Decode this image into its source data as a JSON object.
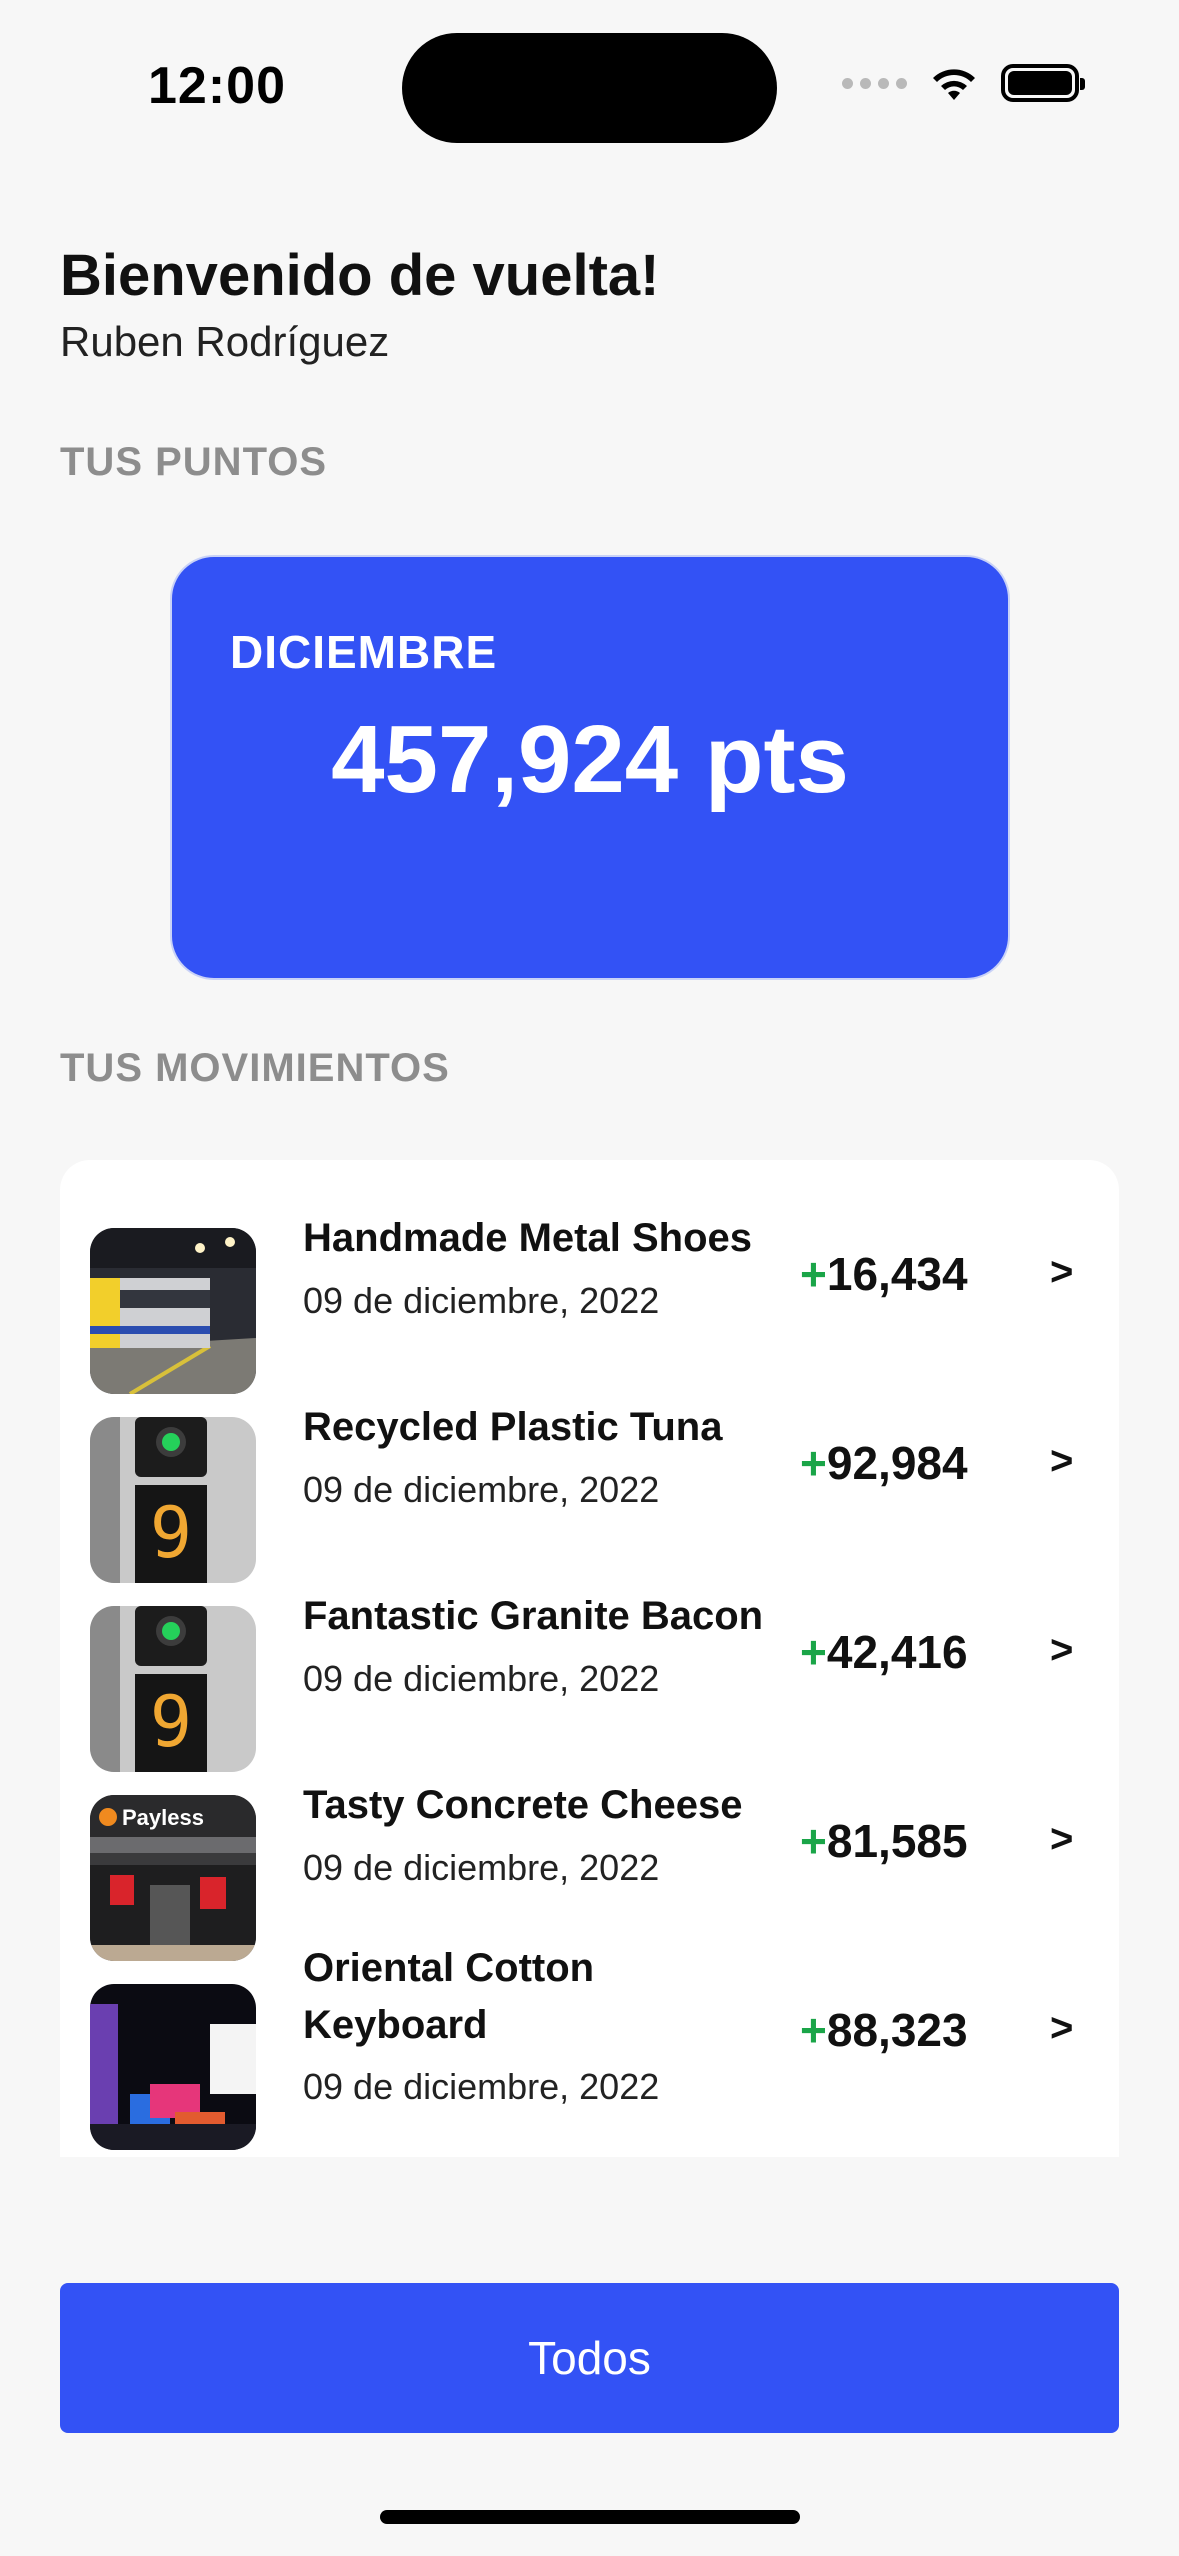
{
  "status_bar": {
    "time": "12:00",
    "icons": [
      "cellular-signal-icon",
      "wifi-icon",
      "battery-icon"
    ]
  },
  "header": {
    "greeting": "Bienvenido de vuelta!",
    "user_name": "Ruben Rodríguez"
  },
  "points": {
    "section_label": "TUS PUNTOS",
    "month": "DICIEMBRE",
    "value": "457,924 pts"
  },
  "movements": {
    "section_label": "TUS MOVIMIENTOS",
    "items": [
      {
        "title": "Handmade Metal Shoes",
        "date": "09 de diciembre, 2022",
        "sign": "+",
        "amount": "16,434",
        "thumb": "train-photo"
      },
      {
        "title": "Recycled Plastic Tuna",
        "date": "09 de diciembre, 2022",
        "sign": "+",
        "amount": "92,984",
        "thumb": "signal-photo"
      },
      {
        "title": "Fantastic Granite Bacon",
        "date": "09 de diciembre, 2022",
        "sign": "+",
        "amount": "42,416",
        "thumb": "signal-photo"
      },
      {
        "title": "Tasty Concrete Cheese",
        "date": "09 de diciembre, 2022",
        "sign": "+",
        "amount": "81,585",
        "thumb": "storefront-photo"
      },
      {
        "title": "Oriental Cotton Keyboard",
        "date": "09 de diciembre, 2022",
        "sign": "+",
        "amount": "88,323",
        "thumb": "city-night-photo"
      }
    ],
    "chevron": ">"
  },
  "actions": {
    "all_button_label": "Todos"
  },
  "colors": {
    "accent": "#3352f5",
    "positive": "#1aa548",
    "background": "#f7f7f7",
    "muted": "#8d8d8d"
  }
}
